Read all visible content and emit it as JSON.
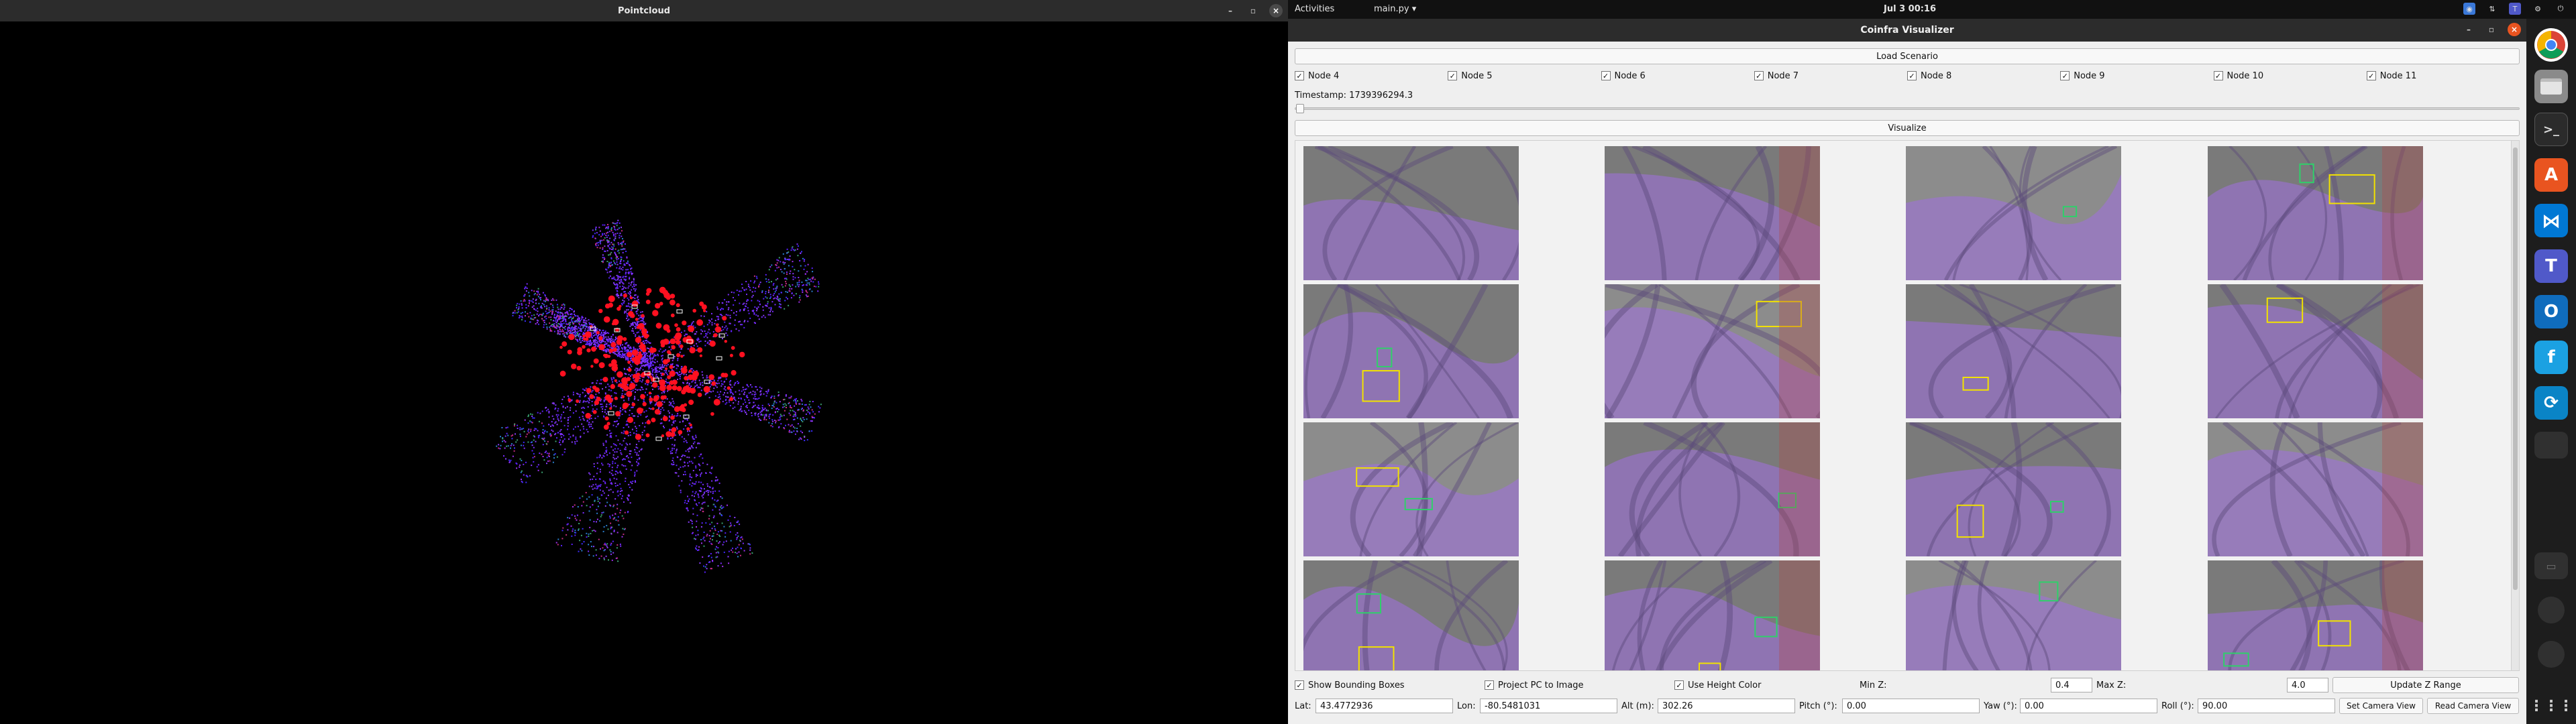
{
  "pointcloud_window": {
    "title": "Pointcloud",
    "controls": {
      "minimize": "–",
      "maximize": "▫",
      "close": "×"
    }
  },
  "topbar": {
    "activities": "Activities",
    "app_menu": "main.py ▾",
    "clock": "Jul 3  00:16",
    "tray_icons": [
      "chrome-tray-icon",
      "network-icon",
      "teams-tray-icon",
      "accessibility-icon",
      "power-icon"
    ]
  },
  "app": {
    "title": "Coinfra Visualizer",
    "load_scenario": "Load Scenario",
    "nodes": [
      {
        "label": "Node 4",
        "checked": true
      },
      {
        "label": "Node 5",
        "checked": true
      },
      {
        "label": "Node 6",
        "checked": true
      },
      {
        "label": "Node 7",
        "checked": true
      },
      {
        "label": "Node 8",
        "checked": true
      },
      {
        "label": "Node 9",
        "checked": true
      },
      {
        "label": "Node 10",
        "checked": true
      },
      {
        "label": "Node 11",
        "checked": true
      }
    ],
    "timestamp": "Timestamp: 1739396294.3",
    "visualize": "Visualize",
    "options": {
      "show_bounding_boxes": "Show Bounding Boxes",
      "project_pc": "Project PC to Image",
      "use_height_color": "Use Height Color",
      "min_z_label": "Min Z:",
      "min_z": "0.4",
      "max_z_label": "Max Z:",
      "max_z": "4.0",
      "update_z": "Update Z Range"
    },
    "coords": {
      "lat_label": "Lat:",
      "lat": "43.4772936",
      "lon_label": "Lon:",
      "lon": "-80.5481031",
      "alt_label": "Alt (m):",
      "alt": "302.26",
      "pitch_label": "Pitch (°):",
      "pitch": "0.00",
      "yaw_label": "Yaw (°):",
      "yaw": "0.00",
      "roll_label": "Roll (°):",
      "roll": "90.00",
      "set_camera": "Set Camera View",
      "read_camera": "Read Camera View"
    }
  },
  "dock": {
    "items": [
      "chrome-icon",
      "files-icon",
      "terminal-icon",
      "software-icon",
      "vscode-icon",
      "teams-icon",
      "outlook-icon",
      "feedback-icon",
      "sync-icon"
    ],
    "colors": {
      "chrome": "#e8453c",
      "files": "#7a7a7a",
      "terminal": "#2d2d2d",
      "software": "#e95420",
      "vscode": "#0078d4",
      "teams": "#5059c9",
      "outlook": "#0f6cbd",
      "feedback": "#1ba1e2",
      "sync": "#0a84c6"
    }
  },
  "colors": {
    "pc_violet": "#7b2cff",
    "pc_red": "#ff1020",
    "overlay_purple": "#a070e0",
    "bbox_yellow": "#f2e200",
    "bbox_green": "#2fd06a"
  }
}
